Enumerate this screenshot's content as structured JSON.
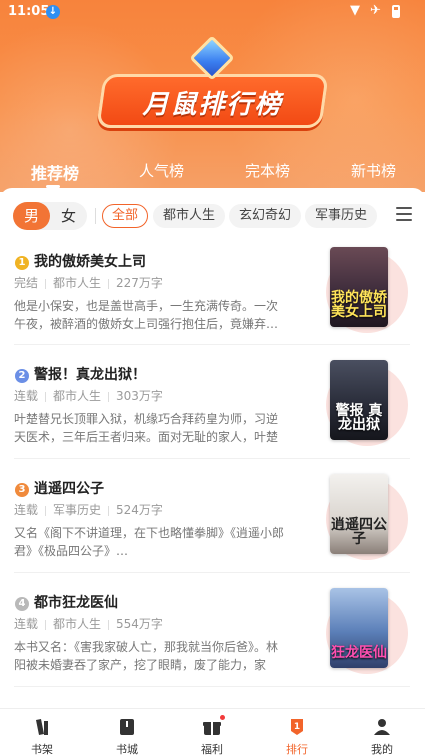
{
  "status": {
    "time": "11:05"
  },
  "banner": {
    "title": "月鼠排行榜"
  },
  "tabs": [
    {
      "label": "推荐榜",
      "active": true
    },
    {
      "label": "人气榜",
      "active": false
    },
    {
      "label": "完本榜",
      "active": false
    },
    {
      "label": "新书榜",
      "active": false
    }
  ],
  "gender": {
    "male": "男",
    "female": "女",
    "selected": "男"
  },
  "categories": [
    {
      "label": "全部",
      "active": true
    },
    {
      "label": "都市人生",
      "active": false
    },
    {
      "label": "玄幻奇幻",
      "active": false
    },
    {
      "label": "军事历史",
      "active": false
    }
  ],
  "books": [
    {
      "rank": "1",
      "title": "我的傲娇美女上司",
      "status": "完结",
      "genre": "都市人生",
      "words": "227万字",
      "desc": "他是小保安，也是盖世高手，一生充满传奇。一次午夜，被醉酒的傲娇女上司强行抱住后，竟嫌弃…",
      "cover_text": "我的傲娇美女上司",
      "cover_color": "#3b2a3a"
    },
    {
      "rank": "2",
      "title": "警报！真龙出狱！",
      "status": "连载",
      "genre": "都市人生",
      "words": "303万字",
      "desc": "叶楚替兄长顶罪入狱，机缘巧合拜药皇为师，习逆天医术，三年后王者归来。面对无耻的家人，叶楚直接断…",
      "cover_text": "警报 真龙出狱",
      "cover_color": "#2a2d3a"
    },
    {
      "rank": "3",
      "title": "逍遥四公子",
      "status": "连载",
      "genre": "军事历史",
      "words": "524万字",
      "desc": "又名《阁下不讲道理，在下也略懂拳脚》《逍遥小郎君》《极品四公子》…",
      "cover_text": "逍遥四公子",
      "cover_color": "#e9e6e2"
    },
    {
      "rank": "4",
      "title": "都市狂龙医仙",
      "status": "连载",
      "genre": "都市人生",
      "words": "554万字",
      "desc": "本书又名：《害我家破人亡，那我就当你后爸》。林阳被未婚妻吞了家产，挖了眼睛，废了能力，家破…",
      "cover_text": "狂龙医仙",
      "cover_color": "#5b7fb8"
    }
  ],
  "nav": [
    {
      "label": "书架",
      "icon": "bookshelf-icon",
      "active": false
    },
    {
      "label": "书城",
      "icon": "bookstore-icon",
      "active": false
    },
    {
      "label": "福利",
      "icon": "gift-icon",
      "active": false
    },
    {
      "label": "排行",
      "icon": "ranking-icon",
      "active": true
    },
    {
      "label": "我的",
      "icon": "profile-icon",
      "active": false
    }
  ],
  "colors": {
    "accent": "#f2642a",
    "header": "#f7833c",
    "rank1": "#f0b323",
    "rank2": "#6b8fe6",
    "rank3": "#f08a3c",
    "rank4": "#b9b9b9"
  }
}
